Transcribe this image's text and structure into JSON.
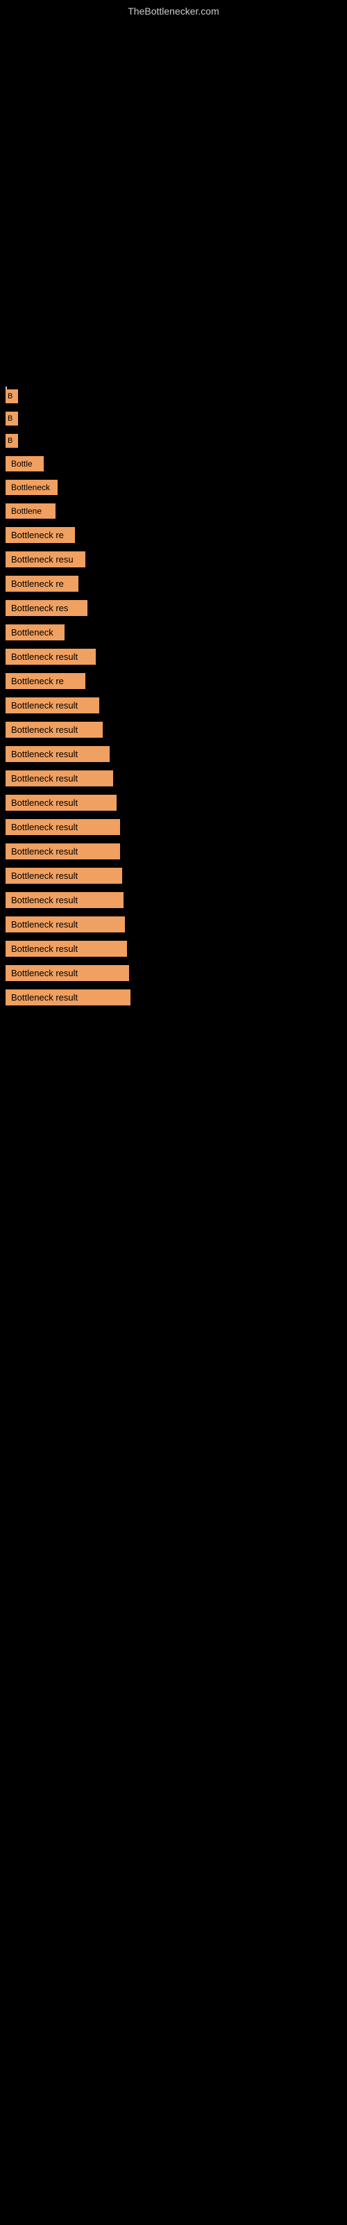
{
  "site": {
    "title": "TheBottlenecker.com"
  },
  "items": [
    {
      "id": 1,
      "label": "B",
      "itemClass": "item-1"
    },
    {
      "id": 2,
      "label": "B",
      "itemClass": "item-2"
    },
    {
      "id": 3,
      "label": "B",
      "itemClass": "item-3"
    },
    {
      "id": 4,
      "label": "Bottle",
      "itemClass": "item-4"
    },
    {
      "id": 5,
      "label": "Bottleneck",
      "itemClass": "item-5"
    },
    {
      "id": 6,
      "label": "Bottlene",
      "itemClass": "item-6"
    },
    {
      "id": 7,
      "label": "Bottleneck re",
      "itemClass": "item-7"
    },
    {
      "id": 8,
      "label": "Bottleneck resu",
      "itemClass": "item-8"
    },
    {
      "id": 9,
      "label": "Bottleneck re",
      "itemClass": "item-9"
    },
    {
      "id": 10,
      "label": "Bottleneck res",
      "itemClass": "item-10"
    },
    {
      "id": 11,
      "label": "Bottleneck",
      "itemClass": "item-11"
    },
    {
      "id": 12,
      "label": "Bottleneck result",
      "itemClass": "item-12"
    },
    {
      "id": 13,
      "label": "Bottleneck re",
      "itemClass": "item-13"
    },
    {
      "id": 14,
      "label": "Bottleneck result",
      "itemClass": "item-14"
    },
    {
      "id": 15,
      "label": "Bottleneck result",
      "itemClass": "item-15"
    },
    {
      "id": 16,
      "label": "Bottleneck result",
      "itemClass": "item-16"
    },
    {
      "id": 17,
      "label": "Bottleneck result",
      "itemClass": "item-17"
    },
    {
      "id": 18,
      "label": "Bottleneck result",
      "itemClass": "item-18"
    },
    {
      "id": 19,
      "label": "Bottleneck result",
      "itemClass": "item-19"
    },
    {
      "id": 20,
      "label": "Bottleneck result",
      "itemClass": "item-20"
    },
    {
      "id": 21,
      "label": "Bottleneck result",
      "itemClass": "item-21"
    },
    {
      "id": 22,
      "label": "Bottleneck result",
      "itemClass": "item-22"
    },
    {
      "id": 23,
      "label": "Bottleneck result",
      "itemClass": "item-23"
    },
    {
      "id": 24,
      "label": "Bottleneck result",
      "itemClass": "item-24"
    },
    {
      "id": 25,
      "label": "Bottleneck result",
      "itemClass": "item-25"
    },
    {
      "id": 26,
      "label": "Bottleneck result",
      "itemClass": "item-26"
    }
  ]
}
